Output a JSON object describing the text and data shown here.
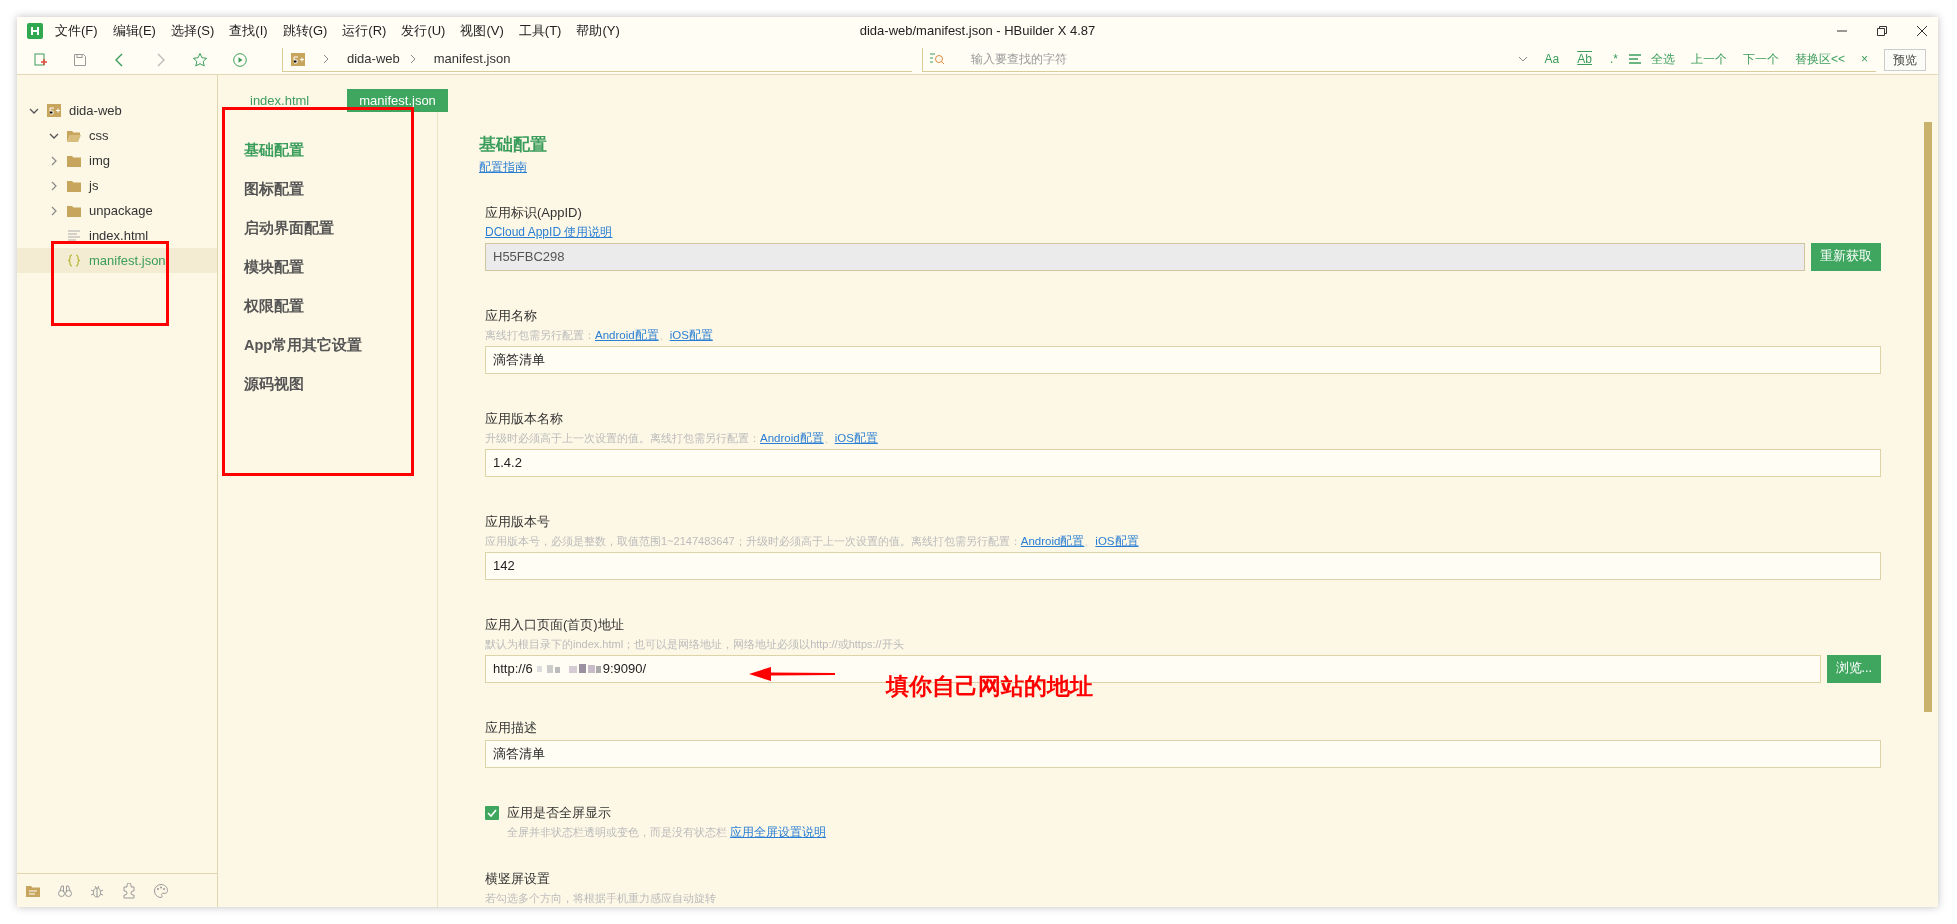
{
  "window": {
    "title": "dida-web/manifest.json - HBuilder X 4.87"
  },
  "menu": [
    "文件(F)",
    "编辑(E)",
    "选择(S)",
    "查找(I)",
    "跳转(G)",
    "运行(R)",
    "发行(U)",
    "视图(V)",
    "工具(T)",
    "帮助(Y)"
  ],
  "toolbar": {
    "breadcrumb": [
      "dida-web",
      "manifest.json"
    ],
    "find_placeholder": "输入要查找的字符",
    "find_options": [
      "Aa",
      "Ab",
      ".*"
    ],
    "find_actions": [
      "全选",
      "上一个",
      "下一个",
      "替换区<<"
    ],
    "close": "×",
    "preview_button": "预览"
  },
  "sidebar": {
    "tree": [
      {
        "label": "dida-web",
        "kind": "project",
        "expanded": true,
        "selected": false,
        "children": [
          {
            "label": "css",
            "kind": "folder",
            "expanded": true,
            "selected": false
          },
          {
            "label": "img",
            "kind": "folder",
            "expanded": false,
            "selected": false
          },
          {
            "label": "js",
            "kind": "folder",
            "expanded": false,
            "selected": false
          },
          {
            "label": "unpackage",
            "kind": "folder",
            "expanded": false,
            "selected": false
          },
          {
            "label": "index.html",
            "kind": "file",
            "selected": false
          },
          {
            "label": "manifest.json",
            "kind": "json",
            "selected": true
          }
        ]
      }
    ]
  },
  "tabs": [
    {
      "label": "index.html",
      "selected": false
    },
    {
      "label": "manifest.json",
      "selected": true
    }
  ],
  "settings_nav": [
    {
      "label": "基础配置",
      "selected": true
    },
    {
      "label": "图标配置",
      "selected": false
    },
    {
      "label": "启动界面配置",
      "selected": false
    },
    {
      "label": "模块配置",
      "selected": false
    },
    {
      "label": "权限配置",
      "selected": false
    },
    {
      "label": "App常用其它设置",
      "selected": false
    },
    {
      "label": "源码视图",
      "selected": false
    }
  ],
  "form": {
    "title": "基础配置",
    "guide_link": "配置指南",
    "fields": [
      {
        "kind": "text",
        "label": "应用标识(AppID)",
        "hint_link": "DCloud AppID 使用说明",
        "value": "H55FBC298",
        "readonly": true,
        "button": "重新获取"
      },
      {
        "kind": "text",
        "label": "应用名称",
        "hint": "离线打包需另行配置：",
        "links": [
          "Android配置",
          "iOS配置"
        ],
        "link_separator": "、",
        "value": "滴答清单",
        "readonly": false
      },
      {
        "kind": "text",
        "label": "应用版本名称",
        "hint": "升级时必须高于上一次设置的值。离线打包需另行配置：",
        "links": [
          "Android配置",
          "iOS配置"
        ],
        "link_separator": "、",
        "value": "1.4.2",
        "readonly": false
      },
      {
        "kind": "text",
        "label": "应用版本号",
        "hint": "应用版本号，必须是整数，取值范围1~2147483647；升级时必须高于上一次设置的值。离线打包需另行配置：",
        "links": [
          "Android配置",
          "iOS配置"
        ],
        "link_separator": "、",
        "value": "142",
        "readonly": false
      },
      {
        "kind": "url",
        "label": "应用入口页面(首页)地址",
        "hint": "默认为根目录下的index.html；也可以是网络地址，网络地址必须以http://或https://开头",
        "value_start": "http://6",
        "value_end": "9:9090/",
        "readonly": false,
        "button": "浏览..."
      },
      {
        "kind": "text",
        "label": "应用描述",
        "value": "滴答清单",
        "readonly": false
      },
      {
        "kind": "checkbox",
        "label": "应用是否全屏显示",
        "checked": true,
        "hint": "全屏并非状态栏透明或变色，而是没有状态栏 ",
        "links": [
          "应用全屏设置说明"
        ]
      },
      {
        "kind": "heading",
        "label": "横竖屏设置",
        "hint": "若勾选多个方向，将根据手机重力感应自动旋转"
      }
    ]
  },
  "annotation": {
    "text": "填你自己网站的地址"
  }
}
